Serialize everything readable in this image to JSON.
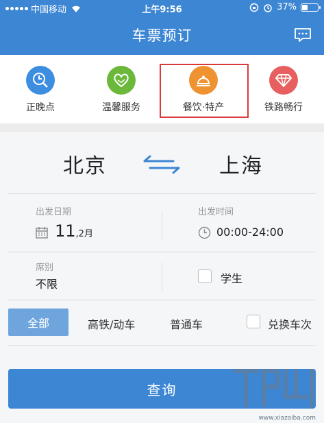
{
  "status_bar": {
    "carrier": "中国移动",
    "time": "上午9:56",
    "battery": "37%",
    "battery_level": 0.37
  },
  "header": {
    "title": "车票预订",
    "message_icon": "chat-bubble-icon"
  },
  "services": [
    {
      "label": "正晚点",
      "icon": "clock-search-icon",
      "color": "#3d8ee0"
    },
    {
      "label": "温馨服务",
      "icon": "heart-hands-icon",
      "color": "#6cb83a"
    },
    {
      "label": "餐饮·特产",
      "icon": "service-bell-icon",
      "color": "#ef9332"
    },
    {
      "label": "铁路畅行",
      "icon": "diamond-icon",
      "color": "#e85f5f"
    }
  ],
  "booking": {
    "from_city": "北京",
    "to_city": "上海",
    "date_label": "出发日期",
    "date_day": "11",
    "date_month": ",2月",
    "time_label": "出发时间",
    "time_value": "00:00-24:00",
    "seat_label": "席别",
    "seat_value": "不限",
    "student_label": "学生",
    "tabs": [
      "全部",
      "高铁/动车",
      "普通车"
    ],
    "swap_label": "兑换车次",
    "query_label": "查询"
  },
  "watermark": {
    "url": "www.xiazaiba.com"
  },
  "colors": {
    "primary": "#3d86d4",
    "highlight_border": "#d83a3a",
    "tab_active": "#6fa5dd"
  }
}
